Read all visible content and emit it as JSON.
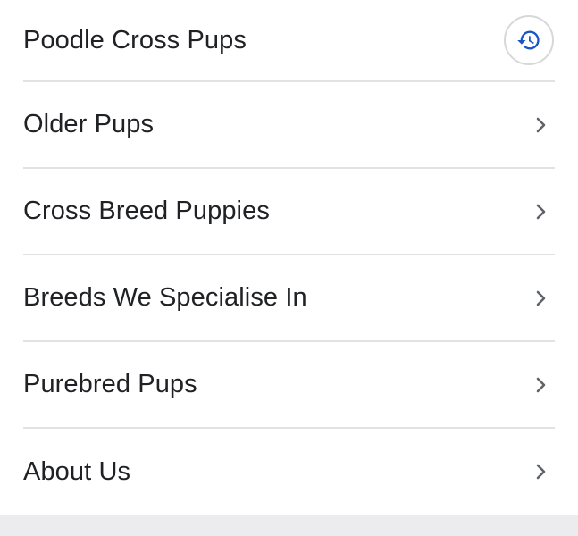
{
  "menu": {
    "items": [
      {
        "label": "Poodle Cross Pups",
        "icon": "history-icon"
      },
      {
        "label": "Older Pups",
        "icon": "chevron-right-icon"
      },
      {
        "label": "Cross Breed Puppies",
        "icon": "chevron-right-icon"
      },
      {
        "label": "Breeds We Specialise In",
        "icon": "chevron-right-icon"
      },
      {
        "label": "Purebred Pups",
        "icon": "chevron-right-icon"
      },
      {
        "label": "About Us",
        "icon": "chevron-right-icon"
      }
    ]
  },
  "colors": {
    "text": "#202124",
    "divider": "#e2e2e2",
    "history_icon": "#1a56c4",
    "chevron": "#5f6368",
    "bottom_band": "#ececee"
  }
}
